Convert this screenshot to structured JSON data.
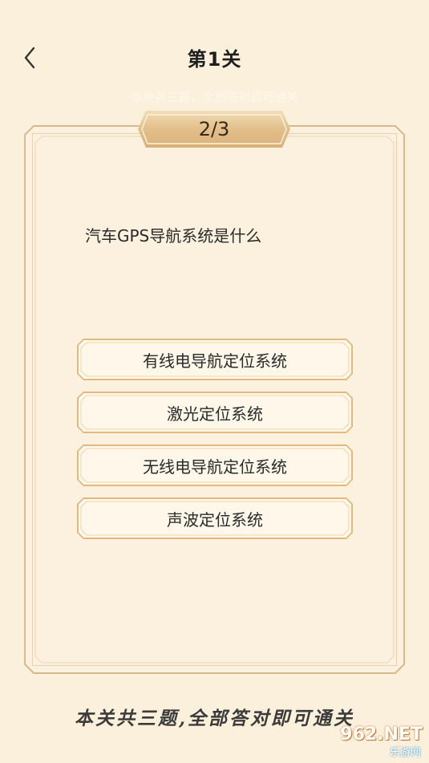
{
  "header": {
    "title": "第1关",
    "faint_hint": "本关共三题，全部答对即可通关"
  },
  "progress": {
    "label": "2/3"
  },
  "question": {
    "text": "汽车GPS导航系统是什么"
  },
  "options": [
    {
      "label": "有线电导航定位系统"
    },
    {
      "label": "激光定位系统"
    },
    {
      "label": "无线电导航定位系统"
    },
    {
      "label": "声波定位系统"
    }
  ],
  "footer": {
    "note": "本关共三题,全部答对即可通关"
  },
  "watermark": {
    "logo_text": "962.NET",
    "sub_text": "乐游网"
  },
  "colors": {
    "background": "#fbf0dc",
    "card_border": "#dcc39f",
    "badge_gold": "#e3bf89",
    "text": "#2a2a2a"
  }
}
